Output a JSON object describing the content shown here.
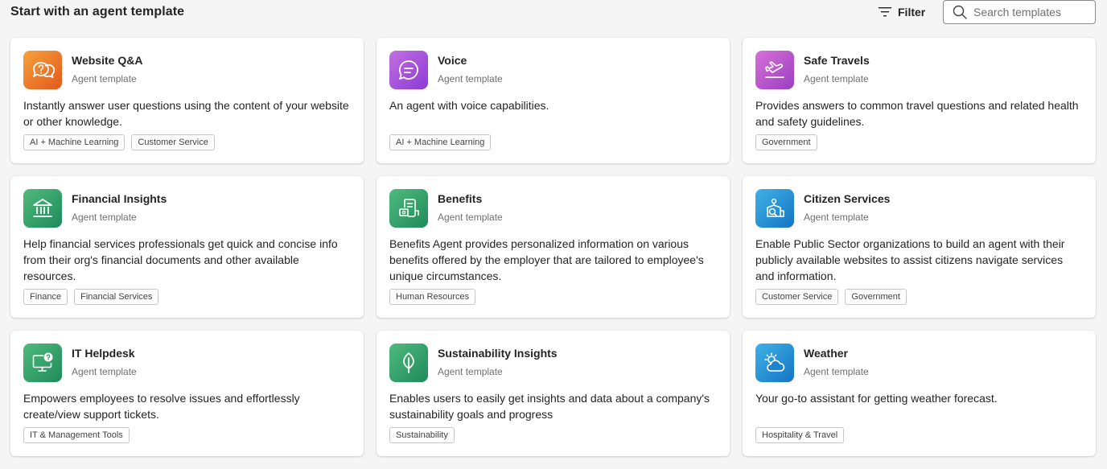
{
  "header": {
    "title": "Start with an agent template",
    "filter_label": "Filter",
    "search_placeholder": "Search templates"
  },
  "cards": [
    {
      "title": "Website Q&A",
      "subtitle": "Agent template",
      "description": "Instantly answer user questions using the content of your website or other knowledge.",
      "tags": [
        "AI + Machine Learning",
        "Customer Service"
      ],
      "icon": "chat-question-icon",
      "color": "#ec7a2c"
    },
    {
      "title": "Voice",
      "subtitle": "Agent template",
      "description": "An agent with voice capabilities.",
      "tags": [
        "AI + Machine Learning"
      ],
      "icon": "speech-bubble-icon",
      "color": "#a955dc"
    },
    {
      "title": "Safe Travels",
      "subtitle": "Agent template",
      "description": "Provides answers to common travel questions and related health and safety guidelines.",
      "tags": [
        "Government"
      ],
      "icon": "airplane-takeoff-icon",
      "color": "#b955cc"
    },
    {
      "title": "Financial Insights",
      "subtitle": "Agent template",
      "description": "Help financial services professionals get quick and concise info from their org's financial documents and other available resources.",
      "tags": [
        "Finance",
        "Financial Services"
      ],
      "icon": "bank-building-icon",
      "color": "#2f9e68"
    },
    {
      "title": "Benefits",
      "subtitle": "Agent template",
      "description": "Benefits Agent provides personalized information on various benefits offered by the employer that are tailored to employee's unique circumstances.",
      "tags": [
        "Human Resources"
      ],
      "icon": "receipt-money-icon",
      "color": "#2f9e68"
    },
    {
      "title": "Citizen Services",
      "subtitle": "Agent template",
      "description": "Enable Public Sector organizations to build an agent with their publicly available websites to assist citizens navigate services and information.",
      "tags": [
        "Customer Service",
        "Government"
      ],
      "icon": "city-search-icon",
      "color": "#2a93d5"
    },
    {
      "title": "IT Helpdesk",
      "subtitle": "Agent template",
      "description": "Empowers employees to resolve issues and effortlessly create/view support tickets.",
      "tags": [
        "IT & Management Tools"
      ],
      "icon": "desktop-help-icon",
      "color": "#2f9e68"
    },
    {
      "title": "Sustainability Insights",
      "subtitle": "Agent template",
      "description": "Enables users to easily get insights and data about a company's sustainability goals and progress",
      "tags": [
        "Sustainability"
      ],
      "icon": "leaf-icon",
      "color": "#2f9e68"
    },
    {
      "title": "Weather",
      "subtitle": "Agent template",
      "description": "Your go-to assistant for getting weather forecast.",
      "tags": [
        "Hospitality & Travel"
      ],
      "icon": "weather-partly-cloudy-icon",
      "color": "#2a93d5"
    }
  ]
}
